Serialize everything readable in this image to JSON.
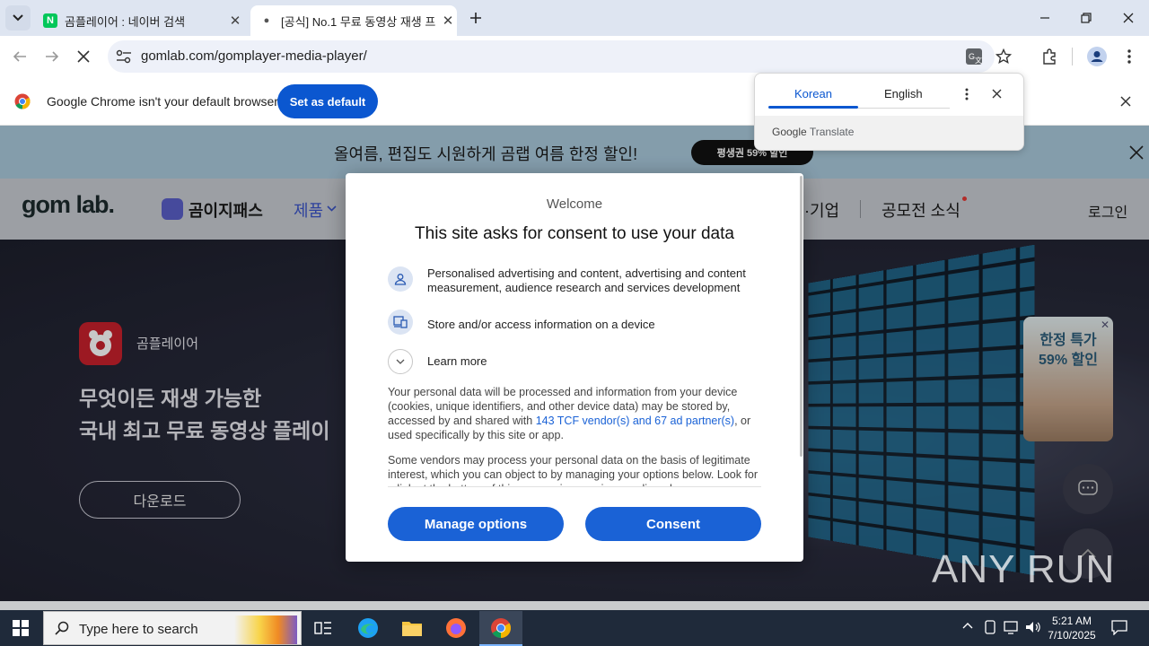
{
  "browser": {
    "tabs": [
      {
        "title": "곰플레이어 : 네이버 검색",
        "favicon": "N"
      },
      {
        "title": "[공식] No.1 무료 동영상 재생 프",
        "favicon": "●"
      }
    ],
    "url": "gomlab.com/gomplayer-media-player/",
    "infobar": {
      "message": "Google Chrome isn't your default browser",
      "button": "Set as default"
    }
  },
  "translate": {
    "tab_source": "Korean",
    "tab_target": "English",
    "brand_google": "Google",
    "brand_translate": "Translate"
  },
  "site": {
    "promo_text": "올여름, 편집도 시원하게 곰랩 여름 한정 할인!",
    "promo_button": "평생권 59% 할인",
    "logo": "gom lab.",
    "nav": {
      "gomi_pass": "곰이지패스",
      "products": "제품",
      "business": "·기업",
      "contest": "공모전 소식",
      "login": "로그인"
    },
    "hero": {
      "app_name": "곰플레이어",
      "headline_1": "무엇이든 재생 가능한",
      "headline_2": "국내 최고 무료 동영상 플레이",
      "download": "다운로드"
    },
    "side_banner": {
      "line1": "한정 특가",
      "line2": "59% 할인"
    },
    "watermark": "ANY RUN"
  },
  "consent": {
    "welcome": "Welcome",
    "title": "This site asks for consent to use your data",
    "purposes": [
      {
        "icon": "person-icon",
        "text": "Personalised advertising and content, advertising and content measurement, audience research and services development"
      },
      {
        "icon": "device-icon",
        "text": "Store and/or access information on a device"
      }
    ],
    "learn_more": "Learn more",
    "para1_a": "Your personal data will be processed and information from your device (cookies, unique identifiers, and other device data) may be stored by, accessed by and shared with ",
    "para1_link": "143 TCF vendor(s) and 67 ad partner(s)",
    "para1_b": ", or used specifically by this site or app.",
    "para2": "Some vendors may process your personal data on the basis of legitimate interest, which you can object to by managing your options below. Look for a link at the bottom of this page or in our privacy policy where you can withdraw consent.",
    "manage": "Manage options",
    "consent": "Consent"
  },
  "taskbar": {
    "search_placeholder": "Type here to search",
    "time": "5:21 AM",
    "date": "7/10/2025"
  },
  "colors": {
    "accent": "#1a62d6",
    "chrome_blue": "#0b57d0",
    "tab_strip": "#dee5f1",
    "promo_bg": "#a9c9dc",
    "taskbar": "#1f2a3a"
  }
}
